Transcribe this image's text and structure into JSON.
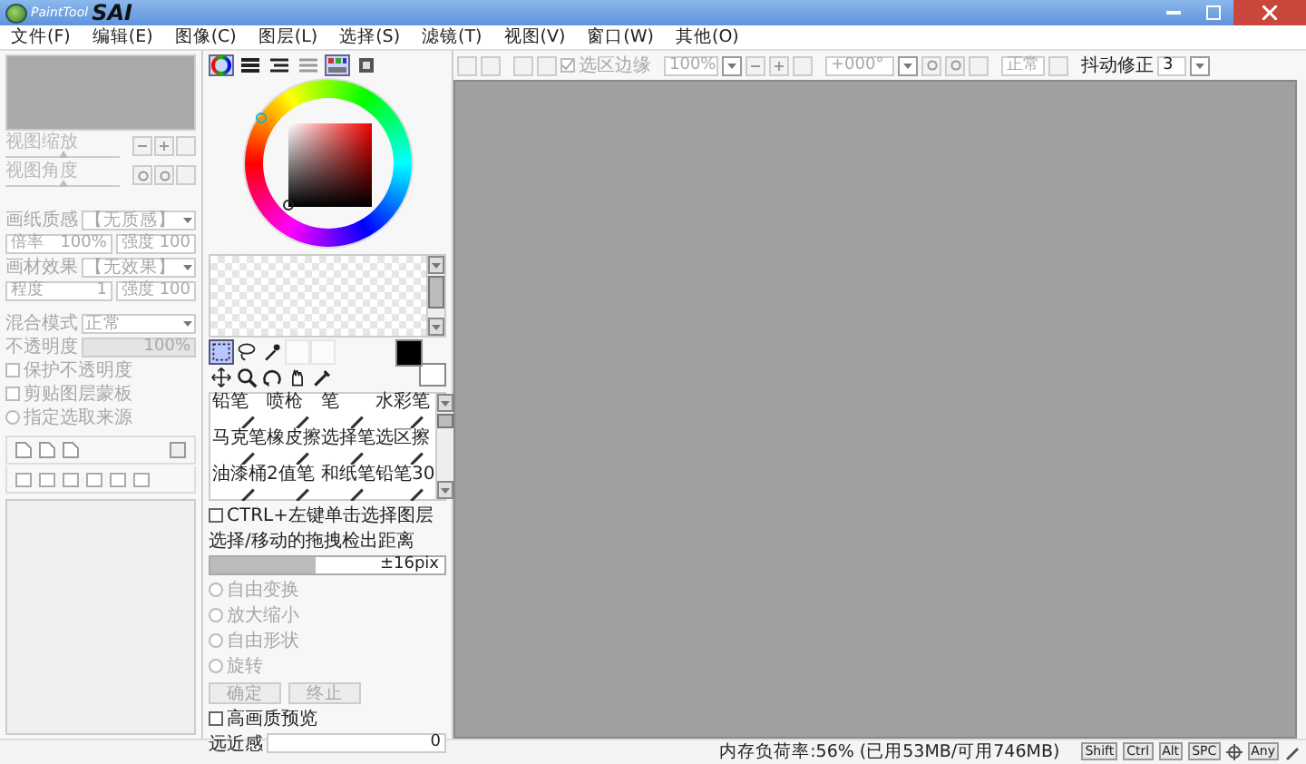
{
  "window": {
    "app_name": "PaintTool",
    "logo": "SAI"
  },
  "menu": [
    "文件(F)",
    "编辑(E)",
    "图像(C)",
    "图层(L)",
    "选择(S)",
    "滤镜(T)",
    "视图(V)",
    "窗口(W)",
    "其他(O)"
  ],
  "navigator": {
    "sliders": [
      {
        "label": "视图缩放",
        "disabled": true,
        "level": 0.5
      },
      {
        "label": "视图角度",
        "disabled": true,
        "level": 0.5
      }
    ]
  },
  "texture": {
    "label": "画纸质感",
    "value": "【无质感】",
    "scale_label": "倍率",
    "scale_value": "100%",
    "strength_label": "强度",
    "strength_value": "100",
    "disabled": true
  },
  "effect": {
    "label": "画材效果",
    "value": "【无效果】",
    "degree_label": "程度",
    "degree_value": "1",
    "strength_label": "强度",
    "strength_value": "100",
    "disabled": true
  },
  "blend": {
    "label": "混合模式",
    "value": "正常",
    "disabled": true
  },
  "opacity": {
    "label": "不透明度",
    "value": "100%",
    "disabled": true,
    "level": 1
  },
  "layer_options": [
    {
      "kind": "checkbox",
      "label": "保护不透明度",
      "checked": false,
      "disabled": true
    },
    {
      "kind": "checkbox",
      "label": "剪贴图层蒙板",
      "checked": false,
      "disabled": true
    },
    {
      "kind": "radio",
      "label": "指定选取来源",
      "selected": false,
      "disabled": true
    }
  ],
  "color_tabs": [
    {
      "kind": "wheel",
      "selected": true
    },
    {
      "kind": "sliders",
      "selected": false
    },
    {
      "kind": "hsv",
      "selected": false
    },
    {
      "kind": "mixer",
      "selected": false
    },
    {
      "kind": "palette",
      "selected": true
    },
    {
      "kind": "scratch",
      "selected": false
    }
  ],
  "tools": [
    {
      "kind": "select",
      "selected": true
    },
    {
      "kind": "lasso",
      "selected": false
    },
    {
      "kind": "wand",
      "selected": false
    },
    {
      "kind": "empty",
      "selected": false
    },
    {
      "kind": "empty",
      "selected": false
    },
    {
      "kind": "move",
      "selected": false
    },
    {
      "kind": "zoom",
      "selected": false
    },
    {
      "kind": "rotate",
      "selected": false
    },
    {
      "kind": "hand",
      "selected": false
    },
    {
      "kind": "dropper",
      "selected": false
    }
  ],
  "brushes": [
    {
      "label": "铅笔",
      "selected": false
    },
    {
      "label": "喷枪",
      "selected": false
    },
    {
      "label": "笔",
      "selected": false
    },
    {
      "label": "水彩笔",
      "selected": false
    },
    {
      "label": "马克笔",
      "selected": false
    },
    {
      "label": "橡皮擦",
      "selected": false
    },
    {
      "label": "选择笔",
      "selected": false
    },
    {
      "label": "选区擦",
      "selected": false
    },
    {
      "label": "油漆桶",
      "selected": false
    },
    {
      "label": "2值笔",
      "selected": false
    },
    {
      "label": "和纸笔",
      "selected": false
    },
    {
      "label": "铅笔30",
      "selected": false
    }
  ],
  "move_tool": {
    "ctrl_click": {
      "label": "CTRL+左键单击选择图层",
      "checked": false
    },
    "drag_label": "选择/移动的拖拽检出距离",
    "drag_value": "±16pix",
    "level": 0.45
  },
  "transform": {
    "options": [
      {
        "label": "自由变换",
        "selected": false
      },
      {
        "label": "放大缩小",
        "selected": false
      },
      {
        "label": "自由形状",
        "selected": false
      },
      {
        "label": "旋转",
        "selected": false
      }
    ],
    "disabled": true,
    "buttons": [
      "确定",
      "终止"
    ]
  },
  "hq_preview": {
    "label": "高画质预览",
    "checked": false
  },
  "perspective": {
    "label": "远近感",
    "value": "0"
  },
  "toolbar": {
    "edge": {
      "label": "选区边缘",
      "checked": true,
      "disabled": true
    },
    "zoom": "100%",
    "angle": "+000°",
    "mode": "正常",
    "stabilizer_label": "抖动修正",
    "stabilizer_value": "3"
  },
  "status": {
    "memory": "内存负荷率:56% (已用53MB/可用746MB)",
    "keys": [
      "Shift",
      "Ctrl",
      "Alt",
      "SPC"
    ],
    "any": "Any"
  }
}
